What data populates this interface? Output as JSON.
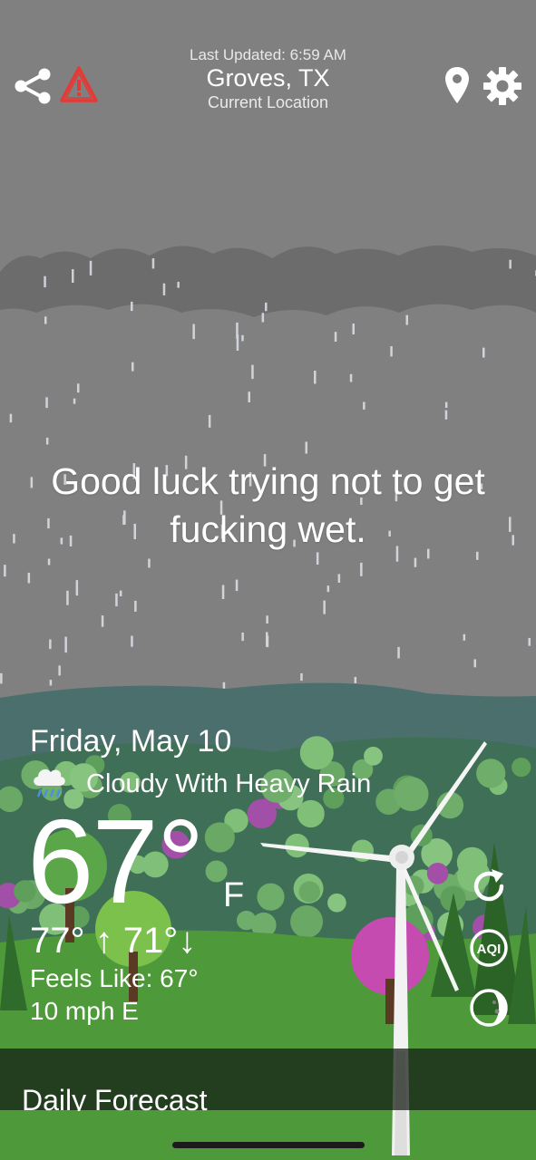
{
  "header": {
    "last_updated": "Last Updated: 6:59 AM",
    "location": "Groves, TX",
    "location_subtitle": "Current Location"
  },
  "message": {
    "line1": "Good luck trying not to get",
    "line2": "fucking wet."
  },
  "current": {
    "date": "Friday, May 10",
    "condition": "Cloudy With Heavy Rain",
    "condition_icon": "cloud-rain-icon",
    "temperature": "67°",
    "unit": "F",
    "high": "77°",
    "low": "71°",
    "feels_like": "Feels Like: 67°",
    "wind": "10 mph E"
  },
  "side_actions": {
    "refresh_icon": "refresh-icon",
    "aqi_label": "AQI",
    "moon_icon": "moon-icon"
  },
  "forecast": {
    "title": "Daily Forecast"
  },
  "colors": {
    "sky": "#808080",
    "clouds": "#6e6e6e",
    "hills": "#4b6f6c",
    "grass": "#4e9a3a",
    "warning_red": "#e53935"
  }
}
